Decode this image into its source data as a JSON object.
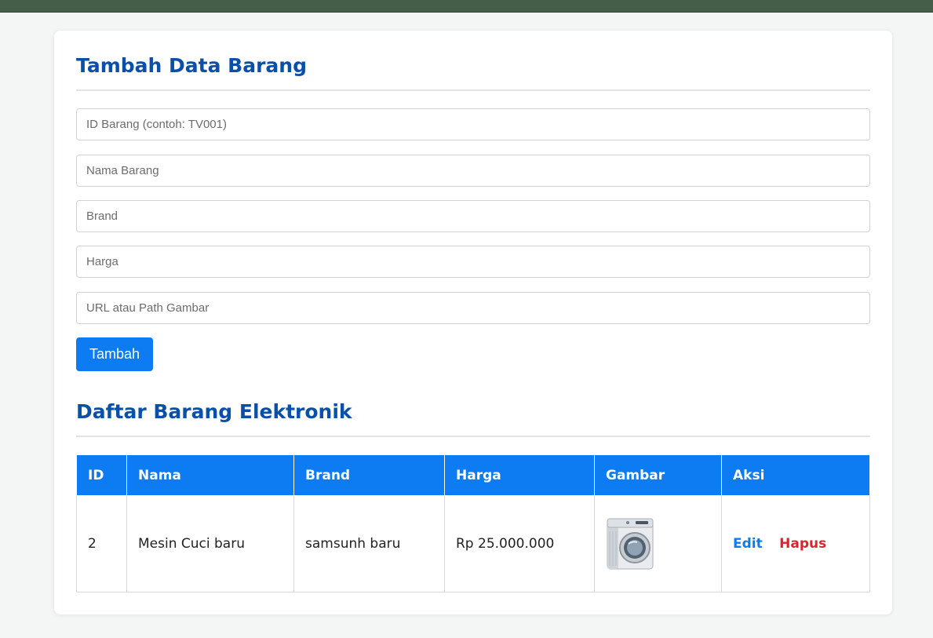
{
  "form": {
    "title": "Tambah Data Barang",
    "fields": [
      {
        "name": "id-barang",
        "placeholder": "ID Barang (contoh: TV001)"
      },
      {
        "name": "nama-barang",
        "placeholder": "Nama Barang"
      },
      {
        "name": "brand",
        "placeholder": "Brand"
      },
      {
        "name": "harga",
        "placeholder": "Harga"
      },
      {
        "name": "gambar",
        "placeholder": "URL atau Path Gambar"
      }
    ],
    "submit_label": "Tambah"
  },
  "list": {
    "title": "Daftar Barang Elektronik",
    "columns": [
      "ID",
      "Nama",
      "Brand",
      "Harga",
      "Gambar",
      "Aksi"
    ],
    "rows": [
      {
        "id": "2",
        "nama": "Mesin Cuci baru",
        "brand": "samsunh baru",
        "harga": "Rp 25.000.000",
        "gambar_icon": "washing-machine-image",
        "edit_label": "Edit",
        "hapus_label": "Hapus"
      }
    ]
  },
  "colors": {
    "accent": "#0d7cf2",
    "heading": "#0a4fa8",
    "danger": "#d6262f",
    "topbar": "#445e4a"
  }
}
